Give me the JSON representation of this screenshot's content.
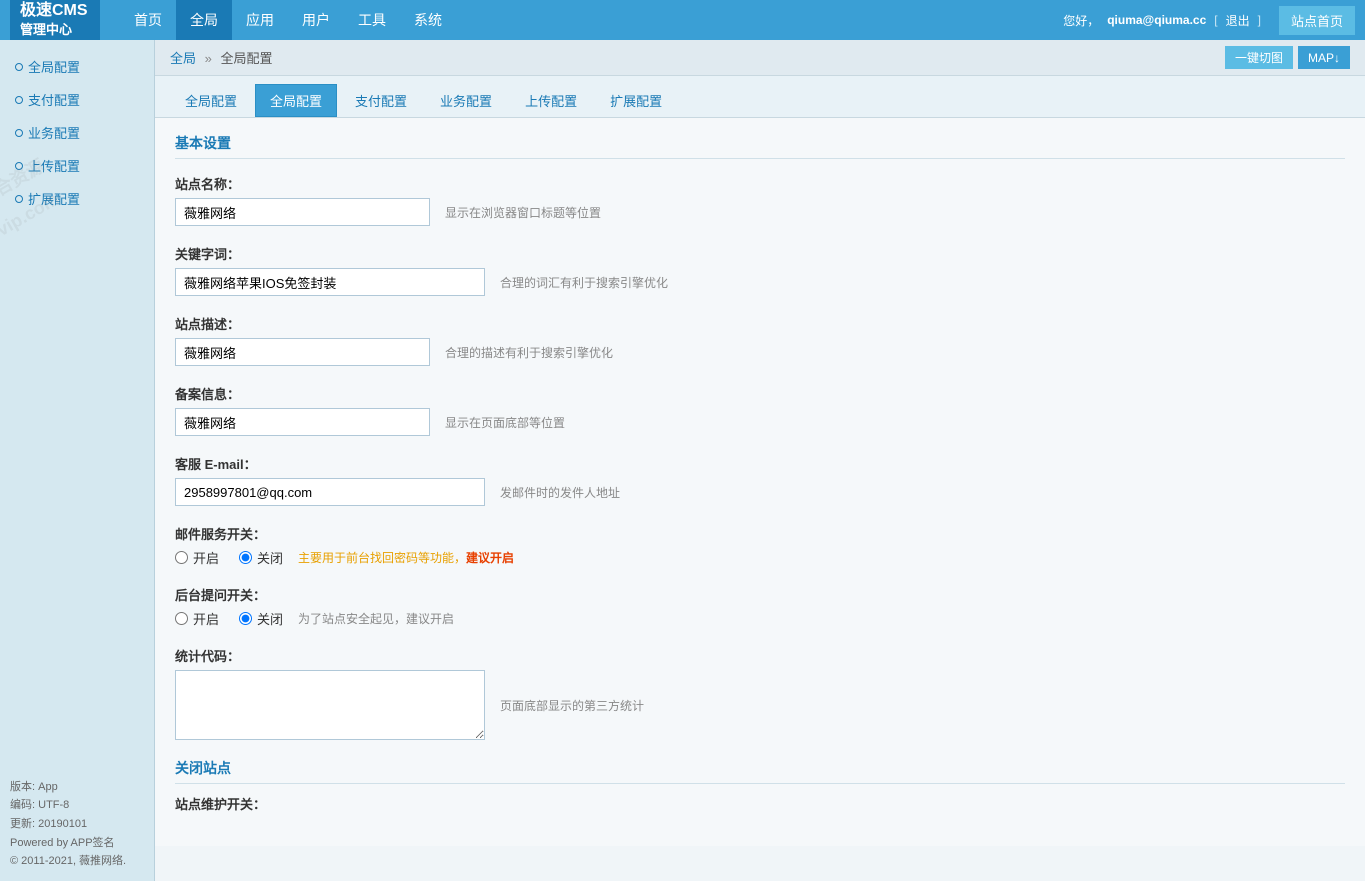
{
  "logo": {
    "line1": "极速CMS",
    "line2": "管理中心"
  },
  "topnav": {
    "links": [
      {
        "label": "首页",
        "active": false
      },
      {
        "label": "全局",
        "active": true
      },
      {
        "label": "应用",
        "active": false
      },
      {
        "label": "用户",
        "active": false
      },
      {
        "label": "工具",
        "active": false
      },
      {
        "label": "系统",
        "active": false
      }
    ],
    "user_prefix": "您好，",
    "username": "qiuma@qiuma.cc",
    "logout_label": "退出",
    "site_home_label": "站点首页"
  },
  "breadcrumb": {
    "parent": "全局",
    "current": "全局配置",
    "btn_switch": "一键切图",
    "btn_map": "MAP↓"
  },
  "sidebar": {
    "items": [
      {
        "label": "全局配置"
      },
      {
        "label": "支付配置"
      },
      {
        "label": "业务配置"
      },
      {
        "label": "上传配置"
      },
      {
        "label": "扩展配置"
      }
    ],
    "footer": {
      "version_label": "版本:",
      "version_value": "App",
      "encoding_label": "编码:",
      "encoding_value": "UTF-8",
      "update_label": "更新:",
      "update_value": "20190101",
      "powered_by": "Powered by APP签名",
      "copyright": "© 2011-2021, 薇推网络."
    }
  },
  "subtabs": {
    "tabs": [
      {
        "label": "全局配置",
        "active": false
      },
      {
        "label": "全局配置",
        "active": true
      },
      {
        "label": "支付配置",
        "active": false
      },
      {
        "label": "业务配置",
        "active": false
      },
      {
        "label": "上传配置",
        "active": false
      },
      {
        "label": "扩展配置",
        "active": false
      }
    ]
  },
  "form": {
    "basic_section": "基本设置",
    "fields": {
      "site_name": {
        "label": "站点名称：",
        "value": "薇雅网络",
        "hint": "显示在浏览器窗口标题等位置"
      },
      "keywords": {
        "label": "关键字词：",
        "value": "薇雅网络苹果IOS免签封装",
        "hint": "合理的词汇有利于搜索引擎优化"
      },
      "description": {
        "label": "站点描述：",
        "value": "薇雅网络",
        "hint": "合理的描述有利于搜索引擎优化"
      },
      "icp": {
        "label": "备案信息：",
        "value": "薇雅网络",
        "hint": "显示在页面底部等位置"
      },
      "email": {
        "label": "客服 E-mail：",
        "value": "2958997801@qq.com",
        "hint": "发邮件时的发件人地址"
      },
      "mail_service": {
        "label": "邮件服务开关：",
        "open_label": "开启",
        "close_label": "关闭",
        "selected": "close",
        "hint_orange": "主要用于前台找回密码等功能，",
        "hint_red": "建议开启"
      },
      "backend_prompt": {
        "label": "后台提问开关：",
        "open_label": "开启",
        "close_label": "关闭",
        "selected": "close",
        "hint": "为了站点安全起见，建议开启"
      },
      "stats_code": {
        "label": "统计代码：",
        "value": "",
        "hint": "页面底部显示的第三方统计"
      }
    },
    "close_section": "关闭站点",
    "site_maintenance": {
      "label": "站点维护开关："
    }
  }
}
